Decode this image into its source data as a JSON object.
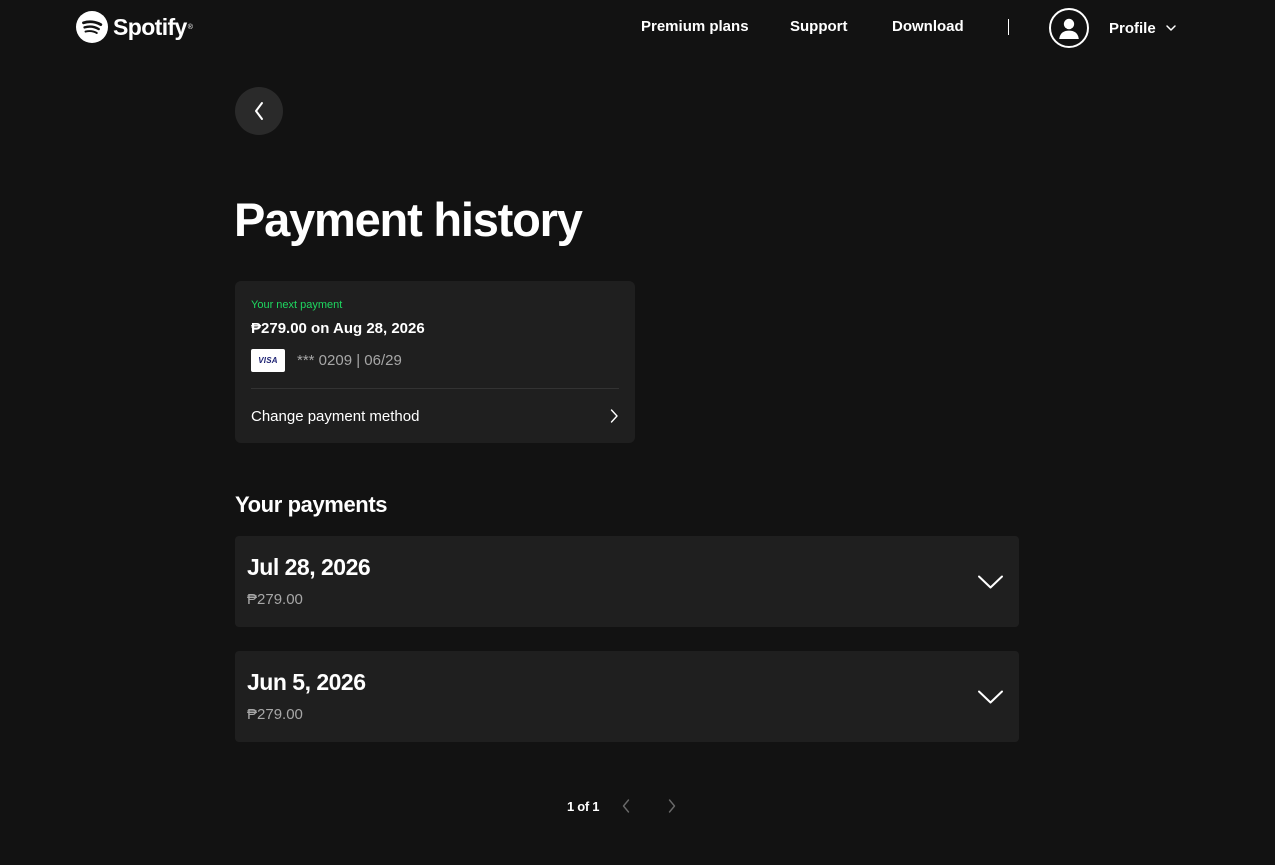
{
  "header": {
    "brand": "Spotify",
    "nav": [
      {
        "label": "Premium plans"
      },
      {
        "label": "Support"
      },
      {
        "label": "Download"
      }
    ],
    "profile_label": "Profile",
    "icons": {
      "logo": "spotify-logo-icon",
      "avatar": "user-icon",
      "profile_menu": "chevron-down-icon"
    }
  },
  "back": {
    "icon": "chevron-left-icon"
  },
  "page_title": "Payment history",
  "next_payment": {
    "label": "Your next payment",
    "amount_text": "₱279.00 on Aug 28, 2026",
    "card_brand": "VISA",
    "card_details": "*** 0209 | 06/29",
    "change_method_label": "Change payment method",
    "change_method_icon": "chevron-right-icon"
  },
  "payments": {
    "title": "Your payments",
    "items": [
      {
        "date": "Jul 28, 2026",
        "amount": "₱279.00"
      },
      {
        "date": "Jun 5, 2026",
        "amount": "₱279.00"
      }
    ],
    "expand_icon": "chevron-down-icon"
  },
  "pagination": {
    "indicator": "1 of 1",
    "prev_icon": "chevron-left-icon",
    "next_icon": "chevron-right-icon"
  },
  "colors": {
    "background": "#121212",
    "card": "#1f1f1f",
    "accent_green": "#1ed760",
    "text_primary": "#ffffff",
    "text_secondary": "#a7a7a7",
    "back_button": "#2a2a2a",
    "disabled_control": "#6a6a6a"
  }
}
